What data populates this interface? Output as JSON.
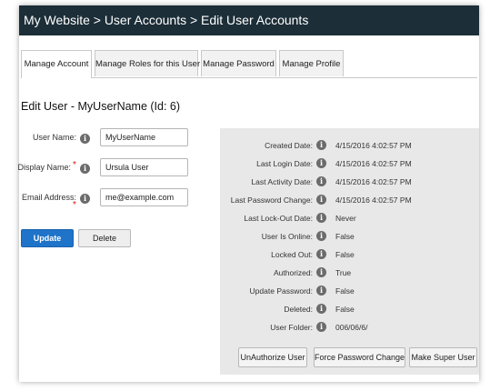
{
  "header": {
    "title": "My Website > User Accounts > Edit User Accounts"
  },
  "tabs": [
    {
      "label": "Manage Account",
      "active": true
    },
    {
      "label": "Manage Roles for this User",
      "active": false
    },
    {
      "label": "Manage Password",
      "active": false
    },
    {
      "label": "Manage Profile",
      "active": false
    }
  ],
  "page": {
    "heading": "Edit User - MyUserName (Id: 6)"
  },
  "form": {
    "info_glyph": "i",
    "required_glyph": "*",
    "username": {
      "label": "User Name:",
      "value": "MyUserName"
    },
    "display_name": {
      "label": "Display Name:",
      "value": "Ursula User"
    },
    "email": {
      "label": "Email Address:",
      "value": "me@example.com"
    },
    "update_label": "Update",
    "delete_label": "Delete"
  },
  "info": {
    "rows": [
      {
        "label": "Created Date:",
        "value": "4/15/2016 4:02:57 PM"
      },
      {
        "label": "Last Login Date:",
        "value": "4/15/2016 4:02:57 PM"
      },
      {
        "label": "Last Activity Date:",
        "value": "4/15/2016 4:02:57 PM"
      },
      {
        "label": "Last Password Change:",
        "value": "4/15/2016 4:02:57 PM"
      },
      {
        "label": "Last Lock-Out Date:",
        "value": "Never"
      },
      {
        "label": "User Is Online:",
        "value": "False"
      },
      {
        "label": "Locked Out:",
        "value": "False"
      },
      {
        "label": "Authorized:",
        "value": "True"
      },
      {
        "label": "Update Password:",
        "value": "False"
      },
      {
        "label": "Deleted:",
        "value": "False"
      },
      {
        "label": "User Folder:",
        "value": "006/06/6/"
      }
    ],
    "buttons": {
      "unauthorize": "UnAuthorize User",
      "force_password": "Force Password Change",
      "make_super": "Make Super User"
    }
  },
  "colors": {
    "titlebar": "#1c2e38",
    "primary_button": "#1f73c9",
    "required": "#dd1111"
  }
}
